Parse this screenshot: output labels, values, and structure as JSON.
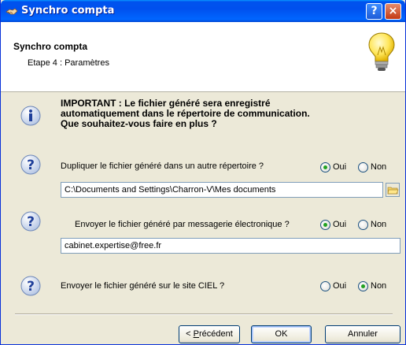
{
  "window": {
    "title": "Synchro compta",
    "help_label": "?",
    "close_label": "×"
  },
  "header": {
    "title": "Synchro compta",
    "subtitle": "Etape 4 : Paramètres"
  },
  "info": {
    "lines": [
      "IMPORTANT : Le fichier généré sera enregistré",
      "automatiquement dans le répertoire de communication.",
      "Que souhaitez-vous faire en plus ?"
    ]
  },
  "questions": [
    {
      "label": "Dupliquer le fichier généré dans un autre répertoire ?",
      "oui_label": "Oui",
      "non_label": "Non",
      "selected": "Oui",
      "field_value": "C:\\Documents and Settings\\Charron-V\\Mes documents"
    },
    {
      "label": "Envoyer le fichier généré par messagerie électronique ?",
      "oui_label": "Oui",
      "non_label": "Non",
      "selected": "Oui",
      "field_value": "cabinet.expertise@free.fr"
    },
    {
      "label": "Envoyer le fichier généré sur le site CIEL ?",
      "oui_label": "Oui",
      "non_label": "Non",
      "selected": "Non"
    }
  ],
  "buttons": {
    "previous_prefix": "< ",
    "previous_underlined": "P",
    "previous_rest": "récédent",
    "ok": "OK",
    "cancel": "Annuler"
  },
  "icons": {
    "app": "handshake-icon",
    "header": "lightbulb-icon",
    "info": "info-icon",
    "question": "question-icon",
    "browse": "folder-browse-icon"
  },
  "colors": {
    "titlebar": "#0054e3",
    "dialog_bg": "#ece9d8",
    "radio_dot": "#21a121"
  }
}
